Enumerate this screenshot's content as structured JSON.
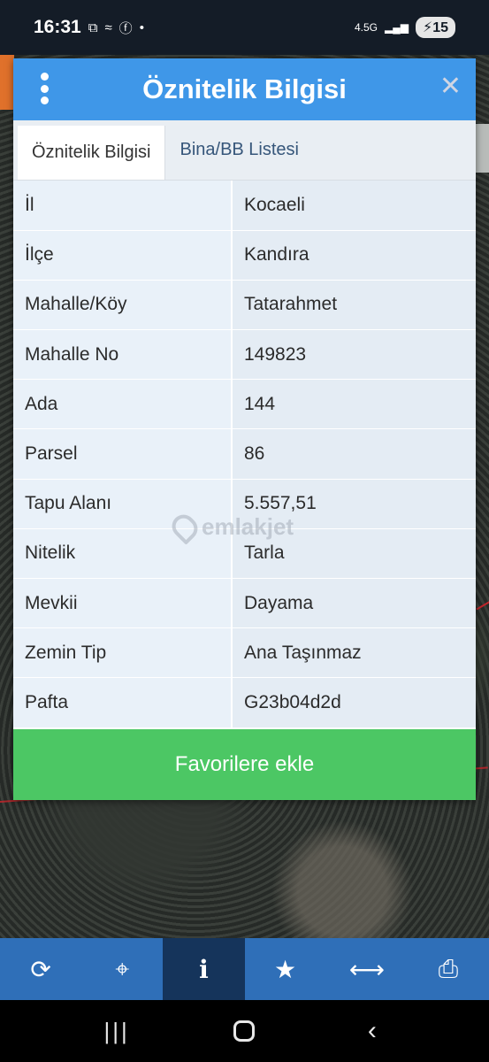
{
  "status_bar": {
    "time": "16:31",
    "icons": [
      "screenshot-icon",
      "signal-slash-icon",
      "facebook-icon",
      "dot-icon"
    ],
    "network": "4.5G",
    "battery": "15"
  },
  "dialog": {
    "title": "Öznitelik Bilgisi",
    "tabs": [
      {
        "label": "Öznitelik Bilgisi",
        "active": true
      },
      {
        "label": "Bina/BB Listesi",
        "active": false
      }
    ],
    "rows": [
      {
        "key": "İl",
        "value": "Kocaeli"
      },
      {
        "key": "İlçe",
        "value": "Kandıra"
      },
      {
        "key": "Mahalle/Köy",
        "value": "Tatarahmet"
      },
      {
        "key": "Mahalle No",
        "value": "149823"
      },
      {
        "key": "Ada",
        "value": "144"
      },
      {
        "key": "Parsel",
        "value": "86"
      },
      {
        "key": "Tapu Alanı",
        "value": "5.557,51"
      },
      {
        "key": "Nitelik",
        "value": "Tarla"
      },
      {
        "key": "Mevkii",
        "value": "Dayama"
      },
      {
        "key": "Zemin Tip",
        "value": "Ana Taşınmaz"
      },
      {
        "key": "Pafta",
        "value": "G23b04d2d"
      }
    ],
    "favorite_button": "Favorilere ekle"
  },
  "watermark": "emlakjet",
  "toolbar": {
    "items": [
      {
        "icon": "refresh-icon",
        "glyph": "⟳"
      },
      {
        "icon": "crosshair-icon",
        "glyph": "⌖"
      },
      {
        "icon": "info-icon",
        "glyph": "i"
      },
      {
        "icon": "star-icon",
        "glyph": "★"
      },
      {
        "icon": "measure-icon",
        "glyph": "⟷"
      },
      {
        "icon": "print-icon",
        "glyph": "⎙"
      }
    ],
    "active_index": 2
  },
  "colors": {
    "header": "#3f97e8",
    "favorite": "#4cc764",
    "toolbar": "#2f6fb8",
    "toolbar_active": "#15345b"
  }
}
